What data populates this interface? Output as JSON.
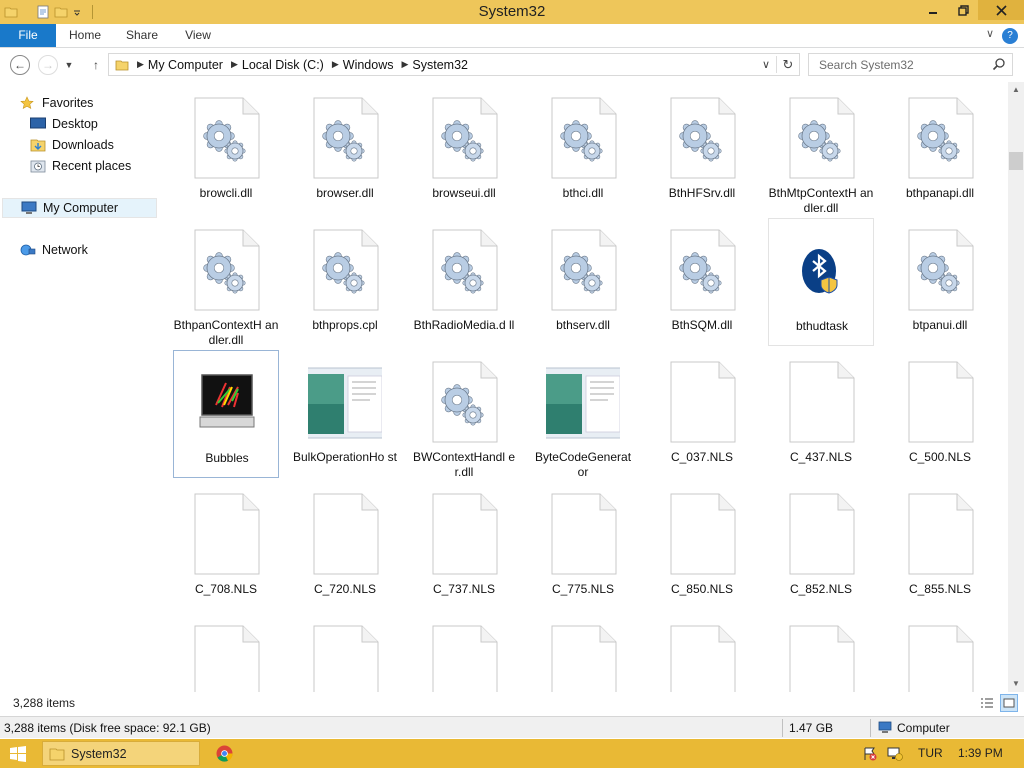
{
  "window": {
    "title": "System32"
  },
  "ribbon": {
    "tabs": [
      "File",
      "Home",
      "Share",
      "View"
    ]
  },
  "address": {
    "crumbs": [
      "My Computer",
      "Local Disk (C:)",
      "Windows",
      "System32"
    ]
  },
  "search": {
    "placeholder": "Search System32"
  },
  "navpane": {
    "favorites": "Favorites",
    "desktop": "Desktop",
    "downloads": "Downloads",
    "recent": "Recent places",
    "computer": "My Computer",
    "network": "Network"
  },
  "files": [
    {
      "name": "browcli.dll",
      "type": "dll"
    },
    {
      "name": "browser.dll",
      "type": "dll"
    },
    {
      "name": "browseui.dll",
      "type": "dll"
    },
    {
      "name": "bthci.dll",
      "type": "dll"
    },
    {
      "name": "BthHFSrv.dll",
      "type": "dll"
    },
    {
      "name": "BthMtpContextH andler.dll",
      "type": "dll"
    },
    {
      "name": "bthpanapi.dll",
      "type": "dll"
    },
    {
      "name": "BthpanContextH andler.dll",
      "type": "dll"
    },
    {
      "name": "bthprops.cpl",
      "type": "dll"
    },
    {
      "name": "BthRadioMedia.d ll",
      "type": "dll"
    },
    {
      "name": "bthserv.dll",
      "type": "dll"
    },
    {
      "name": "BthSQM.dll",
      "type": "dll"
    },
    {
      "name": "bthudtask",
      "type": "bluetooth"
    },
    {
      "name": "btpanui.dll",
      "type": "dll"
    },
    {
      "name": "Bubbles",
      "type": "screensaver"
    },
    {
      "name": "BulkOperationHo st",
      "type": "app"
    },
    {
      "name": "BWContextHandl er.dll",
      "type": "dll"
    },
    {
      "name": "ByteCodeGenerat or",
      "type": "app"
    },
    {
      "name": "C_037.NLS",
      "type": "blank"
    },
    {
      "name": "C_437.NLS",
      "type": "blank"
    },
    {
      "name": "C_500.NLS",
      "type": "blank"
    },
    {
      "name": "C_708.NLS",
      "type": "blank"
    },
    {
      "name": "C_720.NLS",
      "type": "blank"
    },
    {
      "name": "C_737.NLS",
      "type": "blank"
    },
    {
      "name": "C_775.NLS",
      "type": "blank"
    },
    {
      "name": "C_850.NLS",
      "type": "blank"
    },
    {
      "name": "C_852.NLS",
      "type": "blank"
    },
    {
      "name": "C_855.NLS",
      "type": "blank"
    },
    {
      "name": "",
      "type": "blank"
    },
    {
      "name": "",
      "type": "blank"
    },
    {
      "name": "",
      "type": "blank"
    },
    {
      "name": "",
      "type": "blank"
    },
    {
      "name": "",
      "type": "blank"
    },
    {
      "name": "",
      "type": "blank"
    },
    {
      "name": "",
      "type": "blank"
    }
  ],
  "status": {
    "items": "3,288 items"
  },
  "infobar": {
    "left": "3,288 items (Disk free space: 92.1 GB)",
    "size": "1.47 GB",
    "location": "Computer"
  },
  "taskbar": {
    "window": "System32",
    "lang": "TUR",
    "clock": "1:39 PM"
  },
  "colors": {
    "accent": "#1979ca",
    "titlebar": "#eec65a",
    "taskbar": "#e9b935"
  }
}
